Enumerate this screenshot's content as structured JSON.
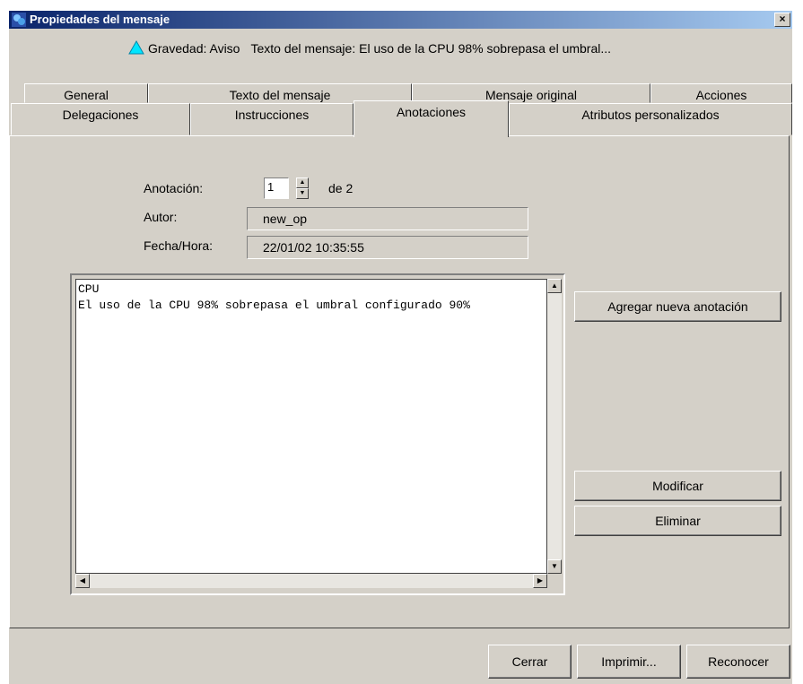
{
  "window": {
    "title": "Propiedades del mensaje",
    "close_label": "x"
  },
  "summary": {
    "severity": "Gravedad: Aviso",
    "message": "Texto del mensaje: El uso de la CPU 98% sobrepasa el umbral..."
  },
  "tabs": {
    "back_row": [
      "General",
      "Texto del mensaje",
      "Mensaje original",
      "Acciones"
    ],
    "front_row": [
      "Delegaciones",
      "Instrucciones",
      "Anotaciones",
      "Atributos personalizados"
    ],
    "active": "Anotaciones"
  },
  "annotation": {
    "label": "Anotación:",
    "index": "1",
    "of_total": "de 2",
    "author_label": "Autor:",
    "author": "new_op",
    "datetime_label": "Fecha/Hora:",
    "datetime": "22/01/02 10:35:55",
    "text": "CPU\nEl uso de la CPU 98% sobrepasa el umbral configurado 90%"
  },
  "buttons": {
    "add": "Agregar nueva anotación",
    "modify": "Modificar",
    "delete": "Eliminar",
    "close": "Cerrar",
    "print": "Imprimir...",
    "acknowledge": "Reconocer"
  },
  "colors": {
    "severity_warning": "#00e5ff",
    "titlebar": "#0a246a"
  },
  "icons": [
    "app-icon",
    "warning-triangle-icon",
    "close-icon"
  ]
}
